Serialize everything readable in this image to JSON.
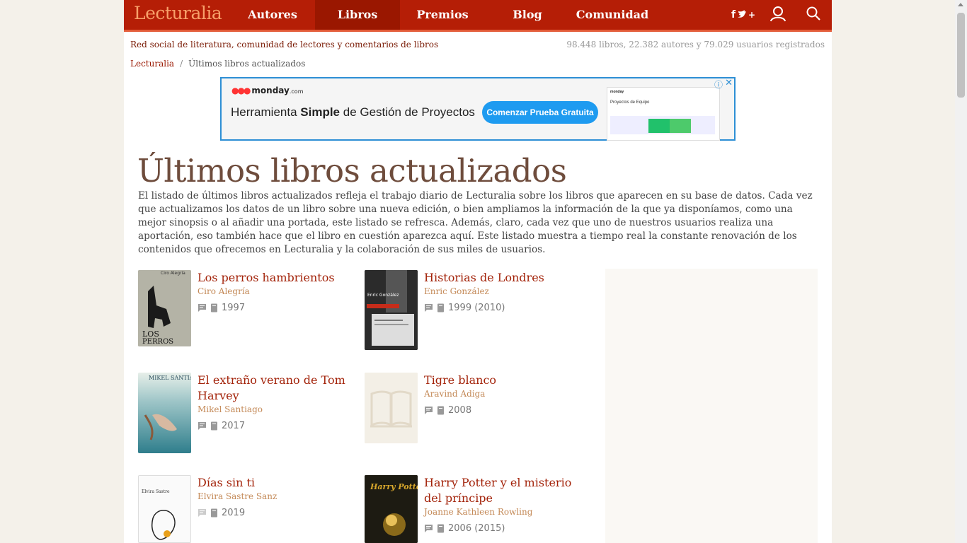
{
  "nav": {
    "logo": "Lecturalia",
    "items": [
      "Autores",
      "Libros",
      "Premios",
      "Blog",
      "Comunidad"
    ],
    "active": "Libros",
    "social_label": "f · +",
    "icons": [
      "facebook-twitter-icon",
      "user-icon",
      "search-icon"
    ]
  },
  "header": {
    "tagline": "Red social de literatura, comunidad de lectores y comentarios de libros",
    "stats": "98.448 libros, 22.382 autores y 79.029 usuarios registrados"
  },
  "breadcrumb": {
    "home": "Lecturalia",
    "separator": "/",
    "current": "Últimos libros actualizados"
  },
  "ad": {
    "brand": "monday",
    "brand_suffix": ".com",
    "text_pre": "Herramienta ",
    "text_bold": "Simple",
    "text_post": " de Gestión de Proyectos",
    "button": "Comenzar Prueba Gratuita",
    "preview_title": "Proyectos de Equipo",
    "preview_brand": "monday",
    "info": "ⓘ",
    "close": "✕"
  },
  "main": {
    "title": "Últimos libros actualizados",
    "intro": "El listado de últimos libros actualizados refleja el trabajo diario de Lecturalia sobre los libros que aparecen en su base de datos. Cada vez que actualizamos los datos de un libro sobre una nueva edición, o bien ampliamos la información de la que ya disponíamos, como una mejor sinopsis o al añadir una portada, este listado se refresca. Además, claro, cada vez que uno de nuestros usuarios realiza una aportación, eso también hace que el libro en cuestión aparezca aquí. Este listado muestra a tiempo real la constante renovación de los contenidos que ofrecemos en Lecturalia y la colaboración de sus miles de usuarios."
  },
  "books": [
    {
      "title": "Los perros hambrientos",
      "author": "Ciro Alegría",
      "year": "1997",
      "cover_text": "Ciro Alegría"
    },
    {
      "title": "Historias de Londres",
      "author": "Enric González",
      "year": "1999 (2010)",
      "cover_text": "Enric González"
    },
    {
      "title": "El extraño verano de Tom Harvey",
      "author": "Mikel Santiago",
      "year": "2017",
      "cover_text": "MIKEL SANTIAGO"
    },
    {
      "title": "Tigre blanco",
      "author": "Aravind Adiga",
      "year": "2008",
      "cover_text": ""
    },
    {
      "title": "Días sin ti",
      "author": "Elvira Sastre Sanz",
      "year": "2019",
      "cover_text": "Elvira Sastre"
    },
    {
      "title": "Harry Potter y el misterio del príncipe",
      "author": "Joanne Kathleen Rowling",
      "year": "2006 (2015)",
      "cover_text": "Harry Potter"
    }
  ]
}
